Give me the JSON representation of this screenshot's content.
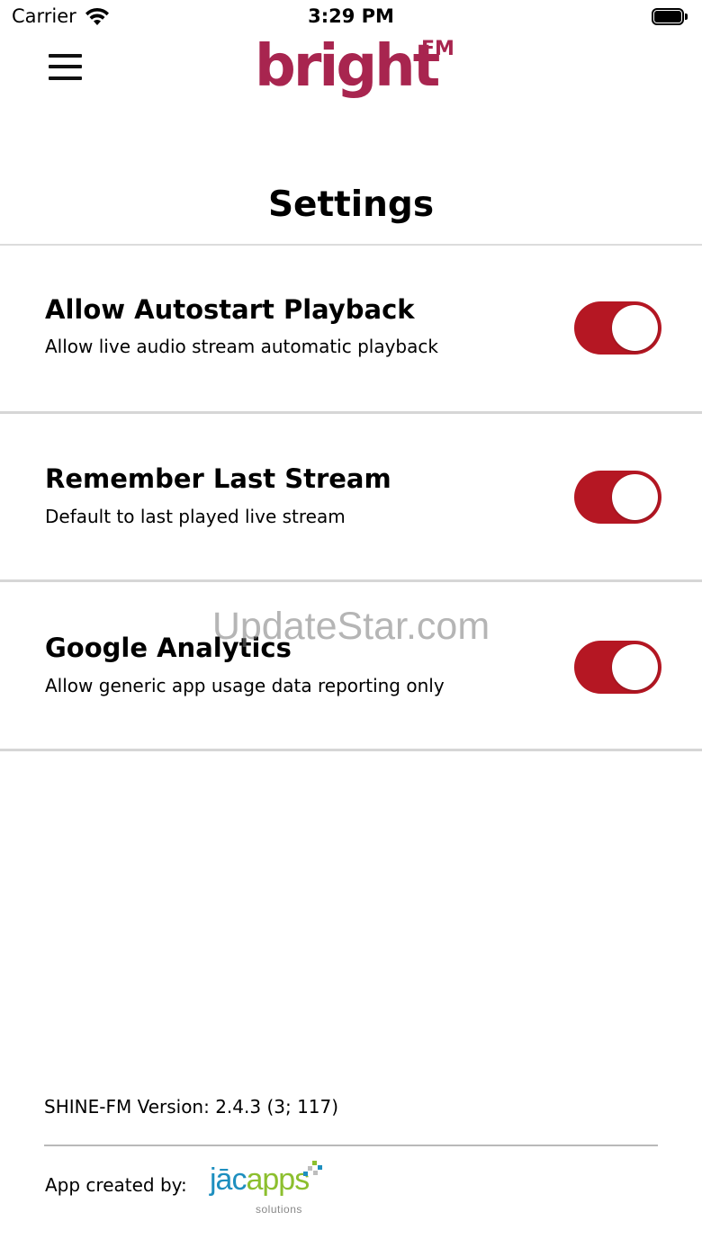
{
  "status_bar": {
    "carrier": "Carrier",
    "time": "3:29 PM"
  },
  "header": {
    "logo_text": "bright",
    "logo_superscript": "FM",
    "brand_color": "#a8254f"
  },
  "page": {
    "title": "Settings"
  },
  "settings": [
    {
      "title": "Allow Autostart Playback",
      "subtitle": "Allow live audio stream automatic playback",
      "enabled": true
    },
    {
      "title": "Remember Last Stream",
      "subtitle": "Default to last played live stream",
      "enabled": true
    },
    {
      "title": "Google Analytics",
      "subtitle": "Allow generic app usage data reporting only",
      "enabled": true
    }
  ],
  "toggle_color": "#b51723",
  "watermark": "UpdateStar.com",
  "footer": {
    "version": "SHINE-FM Version: 2.4.3 (3; 117)",
    "created_by": "App created by:",
    "credit_brand": "jācapps",
    "credit_tagline": "solutions"
  }
}
